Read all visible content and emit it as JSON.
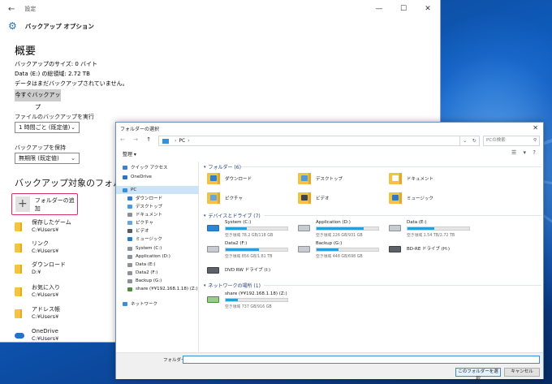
{
  "settings": {
    "window_title": "設定",
    "back_glyph": "←",
    "minimize_glyph": "—",
    "maximize_glyph": "☐",
    "close_glyph": "✕",
    "header_title": "バックアップ オプション",
    "overview_title": "概要",
    "backup_size": "バックアップのサイズ: 0 バイト",
    "total_space": "Data (E:) の総領域: 2.72 TB",
    "not_backed_up": "データはまだバックアップされていません。",
    "backup_now": "今すぐバックアップ",
    "run_label": "ファイルのバックアップを実行",
    "run_value": "1 時間ごと (既定値)",
    "keep_label": "バックアップを保持",
    "keep_value": "無期限 (既定値)",
    "folders_title": "バックアップ対象のフォルダー",
    "add_folder": "フォルダーの追加",
    "folders": [
      {
        "name": "保存したゲーム",
        "path": "C:¥Users¥"
      },
      {
        "name": "リンク",
        "path": "C:¥Users¥"
      },
      {
        "name": "ダウンロード",
        "path": "D:¥"
      },
      {
        "name": "お気に入り",
        "path": "C:¥Users¥"
      },
      {
        "name": "アドレス帳",
        "path": "C:¥Users¥"
      },
      {
        "name": "OneDrive",
        "path": "C:¥Users¥"
      }
    ]
  },
  "dialog": {
    "title": "フォルダーの選択",
    "close_glyph": "✕",
    "nav_glyphs": "← →",
    "up_glyph": "↑",
    "address_pc": "PC",
    "address_chev": "›",
    "address_end": "›",
    "refresh_glyph": "↻",
    "search_placeholder": "PCの検索",
    "search_glyph": "⚲",
    "organize": "整理 ▾",
    "view_glyphs": "☰ ▾ ?",
    "sidebar": [
      {
        "label": "クイック アクセス",
        "color": "#3b7fd4"
      },
      {
        "label": "OneDrive",
        "color": "#2b74c9"
      },
      {
        "label": "PC",
        "color": "#3a8fdc"
      },
      {
        "label": "ダウンロード",
        "color": "#2d7ed6"
      },
      {
        "label": "デスクトップ",
        "color": "#4a9be6"
      },
      {
        "label": "ドキュメント",
        "color": "#8a8f98"
      },
      {
        "label": "ピクチャ",
        "color": "#6aa4d8"
      },
      {
        "label": "ビデオ",
        "color": "#555b63"
      },
      {
        "label": "ミュージック",
        "color": "#2a7bd0"
      },
      {
        "label": "System (C:)",
        "color": "#8b929a"
      },
      {
        "label": "Application (D:)",
        "color": "#8b929a"
      },
      {
        "label": "Data (E:)",
        "color": "#8b929a"
      },
      {
        "label": "Data2 (F:)",
        "color": "#8b929a"
      },
      {
        "label": "Backup (G:)",
        "color": "#8b929a"
      },
      {
        "label": "share (¥¥192.168.1.18) (Z:)",
        "color": "#4b8f3e"
      },
      {
        "label": "ネットワーク",
        "color": "#3a8fdc"
      }
    ],
    "group_folders": "フォルダー (6)",
    "folders": [
      {
        "label": "ダウンロード",
        "overlay": "#2d7ed6"
      },
      {
        "label": "デスクトップ",
        "overlay": "#4a9be6"
      },
      {
        "label": "ドキュメント",
        "overlay": "#ffffff"
      },
      {
        "label": "ピクチャ",
        "overlay": "#6aa4d8"
      },
      {
        "label": "ビデオ",
        "overlay": "#40464d"
      },
      {
        "label": "ミュージック",
        "overlay": "#2a7bd0"
      }
    ],
    "group_drives": "デバイスとドライブ (7)",
    "drives": [
      {
        "name": "System (C:)",
        "size": "空き領域 78.2 GB/118 GB",
        "used": 0.34
      },
      {
        "name": "Application (D:)",
        "size": "空き領域 226 GB/931 GB",
        "used": 0.76
      },
      {
        "name": "Data (E:)",
        "size": "空き領域 1.54 TB/2.72 TB",
        "used": 0.43
      },
      {
        "name": "Data2 (F:)",
        "size": "空き領域 856 GB/1.81 TB",
        "used": 0.54
      },
      {
        "name": "Backup (G:)",
        "size": "空き領域 448 GB/698 GB",
        "used": 0.36
      },
      {
        "name": "BD-RE ドライブ (H:)",
        "size": "",
        "used": null
      },
      {
        "name": "DVD RW ドライブ (I:)",
        "size": "",
        "used": null
      }
    ],
    "group_network": "ネットワークの場所 (1)",
    "network": {
      "name": "share (¥¥192.168.1.18) (Z:)",
      "size": "空き領域 737 GB/916 GB",
      "used": 0.2
    },
    "folder_label": "フォルダー:",
    "folder_value": "",
    "select_button": "このフォルダーを選択",
    "cancel_button": "キャンセル"
  }
}
